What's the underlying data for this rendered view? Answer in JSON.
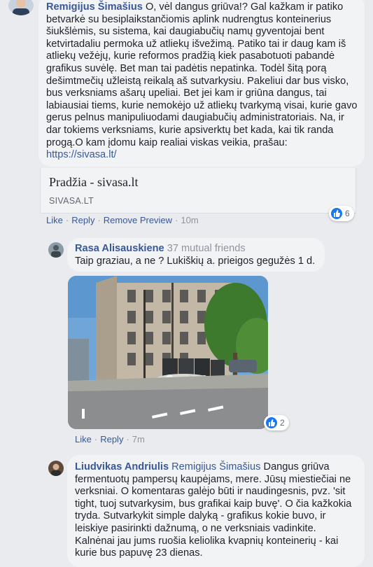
{
  "comments": [
    {
      "author": "Remigijus Šimašius",
      "text": "O, vėl dangus griūva!? Gal kažkam ir patiko betvarkė su besiplaikstančiomis aplink nudrengtus konteinerius šiukšlėmis, su sistema, kai daugiabučių namų gyventojai bent ketvirtadaliu permoka už atliekų išvežimą. Patiko tai ir daug kam iš atliekų vežėjų, kurie reformos pradžią kiek pasabotuoti pabandė grafikus suvėlę. Bet man tai padėtis nepatinka. Todėl šitą porą dešimtmečių užleistą reikalą aš sutvarkysiu. Pakeliui dar bus visko, bus verksniams ašarų upeliai. Bet jei kam ir griūna dangus, tai labiausiai tiems, kurie nemokėjo už atliekų tvarkymą visai, kurie gavo gerus pelnus manipuliuodami daugiabučių administratoriais. Na, ir dar tokiems verksniams, kurie apsiverktų bet kada, kai tik randa progą.O kam įdomu kaip realiai viskas veikia, prašau:",
      "url": "https://sivasa.lt/",
      "preview": {
        "title": "Pradžia - sivasa.lt",
        "domain": "SIVASA.LT"
      },
      "actions": {
        "like": "Like",
        "reply": "Reply",
        "remove_preview": "Remove Preview",
        "time": "10m"
      },
      "reactions": "6"
    },
    {
      "author": "Rasa Alisauskiene",
      "mutual": "37 mutual friends",
      "text": "Taip graziau, a ne ? Lukiškių a. prieigos gegužės 1 d.",
      "actions": {
        "like": "Like",
        "reply": "Reply",
        "time": "7m"
      },
      "reactions": "2"
    },
    {
      "author": "Liudvikas Andriulis",
      "mention": "Remigijus Šimašius",
      "text": "Dangus griūva fermentuotų pampersų kaupėjams, mere. Jūsų miestiečiai ne verksniai. O komentaras galėjo būti ir naudingesnis, pvz. 'sit tight, tuoj sutvarkysim, bus grafikai kaip buvę'. O čia kažkokia tryda. Sutvarkykit simple dalyką - grafikus kokie buvo, ir leiskiye pasirinkti dažnumą, o ne verksniais vadinkite. Kalnėnai jau jums ruošia keliolika kvapnių konteinerių - kai kurie bus papuvę 23 dienas."
    }
  ],
  "colors": {
    "background": "#e9ebee",
    "bubble": "#f2f3f5",
    "link": "#385898",
    "like_blue": "#1877f2"
  },
  "icons": [
    "avatar",
    "like-thumb-icon",
    "street-photo"
  ]
}
